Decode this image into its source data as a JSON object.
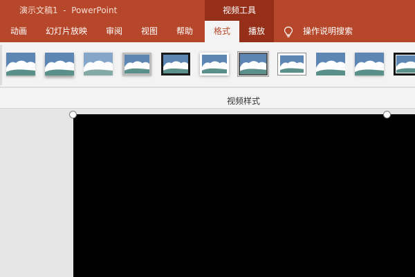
{
  "title_bar": {
    "title": "演示文稿1  -  PowerPoint",
    "context_tab": "视频工具"
  },
  "tabs": [
    {
      "label": "动画",
      "active": false
    },
    {
      "label": "幻灯片放映",
      "active": false
    },
    {
      "label": "审阅",
      "active": false
    },
    {
      "label": "视图",
      "active": false
    },
    {
      "label": "帮助",
      "active": false
    },
    {
      "label": "格式",
      "active": true
    },
    {
      "label": "播放",
      "active": false
    }
  ],
  "tell_me": {
    "icon": "lightbulb-icon",
    "label": "操作说明搜索"
  },
  "ribbon": {
    "group_label": "视频样式",
    "video_styles": [
      {
        "style": "plain"
      },
      {
        "style": "soft-shadow"
      },
      {
        "style": "soft-edge"
      },
      {
        "style": "thick-frame"
      },
      {
        "style": "black-frame"
      },
      {
        "style": "white-frame"
      },
      {
        "style": "double-frame"
      },
      {
        "style": "white-matte"
      },
      {
        "style": "reflection"
      },
      {
        "style": "bevel"
      },
      {
        "style": "black-border"
      }
    ]
  },
  "colors": {
    "accent": "#b7472a",
    "accent_dark": "#962f1a",
    "ribbon": "#f3f3f3",
    "video": "#000000"
  }
}
